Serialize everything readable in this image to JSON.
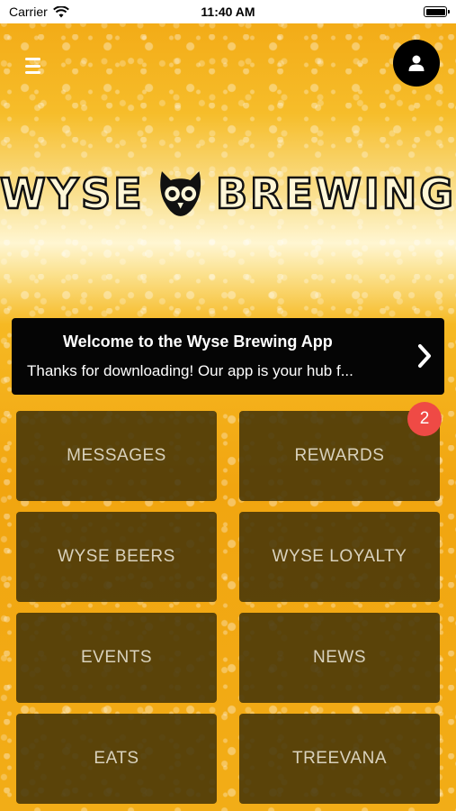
{
  "status_bar": {
    "carrier": "Carrier",
    "time": "11:40 AM"
  },
  "header": {
    "menu_icon": "hamburger-menu-icon",
    "profile_icon": "user-profile-icon"
  },
  "logo": {
    "left_text": "WYSE",
    "right_text": "BREWING",
    "emblem_icon": "owl-icon"
  },
  "banner": {
    "title": "Welcome to the Wyse Brewing App",
    "body": "Thanks for downloading! Our app is your hub f...",
    "chevron_icon": "chevron-right-icon"
  },
  "tiles": [
    {
      "label": "MESSAGES"
    },
    {
      "label": "REWARDS",
      "badge": "2"
    },
    {
      "label": "WYSE BEERS"
    },
    {
      "label": "WYSE LOYALTY"
    },
    {
      "label": "EVENTS"
    },
    {
      "label": "NEWS"
    },
    {
      "label": "EATS"
    },
    {
      "label": "TREEVANA"
    }
  ],
  "colors": {
    "background": "#f2ad17",
    "tile": "#443408",
    "banner": "#050505",
    "badge": "#ef4a45"
  }
}
